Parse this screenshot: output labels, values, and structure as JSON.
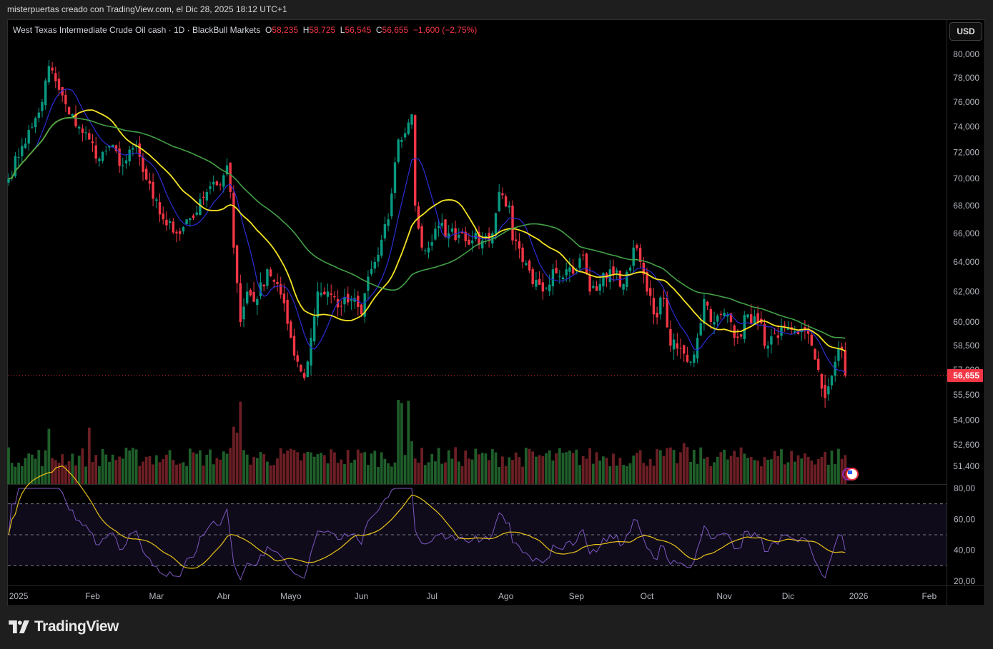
{
  "header": {
    "attribution": "misterpuertas creado con TradingView.com, el Dic 28, 2025 18:12 UTC+1"
  },
  "legend": {
    "symbol": "West Texas Intermediate Crude Oil cash · 1D · BlackBull Markets",
    "o_label": "O",
    "o": "58,235",
    "h_label": "H",
    "h": "58,725",
    "l_label": "L",
    "l": "56,545",
    "c_label": "C",
    "c": "56,655",
    "change": "−1,600 (−2,75%)"
  },
  "currency_button": "USD",
  "footer": {
    "brand": "TradingView"
  },
  "colors": {
    "up": "#089981",
    "down": "#f23645",
    "ma_fast": "#2c2cd8",
    "ma_mid": "#f5e323",
    "ma_slow": "#43a047",
    "rsi": "#7e57c2",
    "rsi_ma": "#e8c21a"
  },
  "chart_data": {
    "type": "candlestick",
    "title": "West Texas Intermediate Crude Oil cash · 1D",
    "price_scale": "log",
    "ylim": [
      51400,
      80000
    ],
    "price_ticks": [
      "80,000",
      "78,000",
      "76,000",
      "74,000",
      "72,000",
      "70,000",
      "68,000",
      "66,000",
      "64,000",
      "62,000",
      "60,000",
      "58,500",
      "57,000",
      "55,500",
      "54,000",
      "52,600",
      "51,400"
    ],
    "price_tick_values": [
      80000,
      78000,
      76000,
      74000,
      72000,
      70000,
      68000,
      66000,
      64000,
      62000,
      60000,
      58500,
      57000,
      55500,
      54000,
      52600,
      51400
    ],
    "last_price_label": "56,655",
    "last_price": 56655,
    "x_ticks": [
      {
        "label": "2025",
        "bar": 3
      },
      {
        "label": "Feb",
        "bar": 25
      },
      {
        "label": "Mar",
        "bar": 44
      },
      {
        "label": "Abr",
        "bar": 64
      },
      {
        "label": "Mayo",
        "bar": 84
      },
      {
        "label": "Jun",
        "bar": 105
      },
      {
        "label": "Jul",
        "bar": 126
      },
      {
        "label": "Ago",
        "bar": 148
      },
      {
        "label": "Sep",
        "bar": 169
      },
      {
        "label": "Oct",
        "bar": 190
      },
      {
        "label": "Nov",
        "bar": 213
      },
      {
        "label": "Dic",
        "bar": 232
      },
      {
        "label": "2026",
        "bar": 253
      },
      {
        "label": "Feb",
        "bar": 274
      }
    ],
    "bar_count": 250,
    "close_path": [
      [
        0,
        70
      ],
      [
        4,
        72.5
      ],
      [
        7,
        74
      ],
      [
        10,
        76
      ],
      [
        12,
        79
      ],
      [
        15,
        77
      ],
      [
        18,
        75
      ],
      [
        21,
        74
      ],
      [
        24,
        73
      ],
      [
        27,
        71.5
      ],
      [
        30,
        72.5
      ],
      [
        34,
        71
      ],
      [
        38,
        72.5
      ],
      [
        40,
        70.5
      ],
      [
        43,
        68.5
      ],
      [
        46,
        67
      ],
      [
        50,
        66
      ],
      [
        53,
        67
      ],
      [
        56,
        67.5
      ],
      [
        59,
        69
      ],
      [
        62,
        69.5
      ],
      [
        65,
        71
      ],
      [
        66,
        69
      ],
      [
        67,
        65
      ],
      [
        69,
        60
      ],
      [
        71,
        62
      ],
      [
        74,
        61.5
      ],
      [
        77,
        63.5
      ],
      [
        80,
        62.5
      ],
      [
        84,
        59
      ],
      [
        86,
        57.5
      ],
      [
        88,
        56.5
      ],
      [
        90,
        59
      ],
      [
        92,
        62
      ],
      [
        95,
        62
      ],
      [
        99,
        61
      ],
      [
        102,
        61.5
      ],
      [
        105,
        60.5
      ],
      [
        107,
        63
      ],
      [
        110,
        64.5
      ],
      [
        113,
        67
      ],
      [
        116,
        73
      ],
      [
        118,
        73.5
      ],
      [
        120,
        75
      ],
      [
        121,
        68
      ],
      [
        123,
        65
      ],
      [
        125,
        65
      ],
      [
        128,
        66.5
      ],
      [
        131,
        66
      ],
      [
        135,
        66
      ],
      [
        138,
        65.5
      ],
      [
        141,
        65.5
      ],
      [
        144,
        66
      ],
      [
        146,
        69
      ],
      [
        149,
        68
      ],
      [
        150,
        65.5
      ],
      [
        153,
        64
      ],
      [
        156,
        62.5
      ],
      [
        159,
        62
      ],
      [
        162,
        63.5
      ],
      [
        166,
        63.5
      ],
      [
        169,
        63.5
      ],
      [
        171,
        64.5
      ],
      [
        173,
        62
      ],
      [
        176,
        62.5
      ],
      [
        179,
        63.5
      ],
      [
        183,
        62.5
      ],
      [
        186,
        65
      ],
      [
        188,
        64
      ],
      [
        190,
        62
      ],
      [
        192,
        60.5
      ],
      [
        195,
        61.5
      ],
      [
        197,
        58.5
      ],
      [
        201,
        58
      ],
      [
        203,
        57.5
      ],
      [
        205,
        59
      ],
      [
        207,
        61.5
      ],
      [
        210,
        60
      ],
      [
        214,
        60.5
      ],
      [
        217,
        59
      ],
      [
        220,
        60.5
      ],
      [
        223,
        60
      ],
      [
        226,
        58.5
      ],
      [
        229,
        59
      ],
      [
        233,
        59.5
      ],
      [
        236,
        59.5
      ],
      [
        239,
        58.5
      ],
      [
        241,
        57
      ],
      [
        243,
        55.3
      ],
      [
        244,
        56
      ],
      [
        246,
        57.5
      ],
      [
        248,
        58.3
      ],
      [
        249,
        56.655
      ]
    ],
    "last_bar": {
      "open": 58235,
      "high": 58725,
      "low": 56545,
      "close": 56655
    },
    "volume_spikes": [
      [
        67,
        3.2
      ],
      [
        68,
        2.6
      ],
      [
        69,
        2.4
      ],
      [
        116,
        3.2
      ],
      [
        117,
        2.2
      ],
      [
        119,
        2.8
      ],
      [
        120,
        2.4
      ],
      [
        12,
        1.6
      ],
      [
        24,
        1.6
      ],
      [
        201,
        1.5
      ]
    ],
    "moving_averages": [
      {
        "name": "MA 9",
        "period": 9
      },
      {
        "name": "MA 20",
        "period": 20
      },
      {
        "name": "MA 50",
        "period": 50
      }
    ],
    "rsi": {
      "period": 14,
      "ma_period": 14,
      "ylim": [
        20,
        80
      ],
      "levels": [
        70,
        50,
        30
      ],
      "ticks": [
        "80,00",
        "60,00",
        "40,00",
        "20,00"
      ],
      "tick_values": [
        80,
        60,
        40,
        20
      ]
    }
  }
}
